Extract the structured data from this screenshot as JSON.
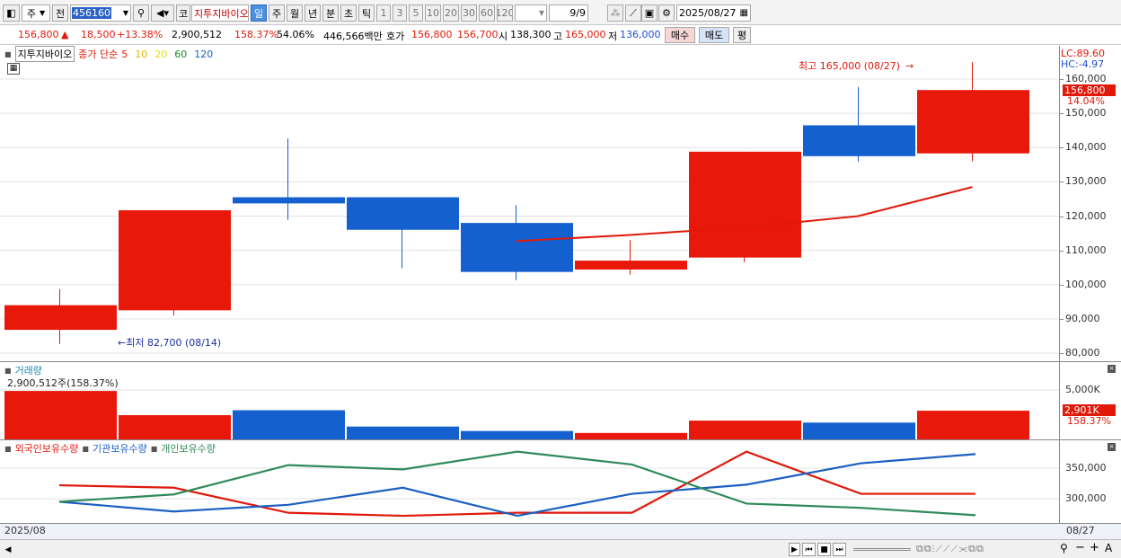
{
  "toolbar": {
    "period_type": "주",
    "prev_label": "전",
    "code": "456160",
    "stock_name": "지투지바이오",
    "kospi_label": "코",
    "periods": [
      "일",
      "주",
      "월",
      "년",
      "분",
      "초",
      "틱"
    ],
    "selected_period": "일",
    "intervals": [
      "1",
      "3",
      "5",
      "10",
      "20",
      "30",
      "60",
      "120"
    ],
    "page": "9/9",
    "date": "2025/08/27"
  },
  "infobar": {
    "price": "156,800",
    "change_arrow": "▲",
    "change": "18,500",
    "change_pct": "+13.38%",
    "volume": "2,900,512",
    "volume_pct": "158.37%",
    "turnover": "54.06%",
    "amount": "446,566백만",
    "quote_label": "호가",
    "ask": "156,800",
    "bid": "156,700",
    "open_label": "시",
    "open": "138,300",
    "high_label": "고",
    "high": "165,000",
    "low_label": "저",
    "low": "136,000",
    "buy_button": "매수",
    "sell_button": "매도",
    "eval_button": "평"
  },
  "chart_header": {
    "name": "지투지바이오",
    "ma_label": "종가 단순",
    "ma_periods": [
      {
        "label": "5",
        "color": "#e0190b"
      },
      {
        "label": "10",
        "color": "#e8b400"
      },
      {
        "label": "20",
        "color": "#e8e000"
      },
      {
        "label": "60",
        "color": "#1b8a2b"
      },
      {
        "label": "120",
        "color": "#1b5fc0"
      }
    ],
    "lc": "LC:89.60",
    "hc": "HC:-4.97"
  },
  "annotations": {
    "high": "최고 165,000 (08/27)",
    "low": "최저 82,700 (08/14)",
    "price_tag": "156,800",
    "price_pct": "14.04%"
  },
  "volume_panel": {
    "title": "거래량",
    "readout": "2,900,512주(158.37%)",
    "tag": "2,901K",
    "tag_pct": "158.37%"
  },
  "holdings_panel": {
    "legend": [
      {
        "label": "외국인보유수량",
        "color": "#e0190b"
      },
      {
        "label": "기관보유수량",
        "color": "#1b5fc0"
      },
      {
        "label": "개인보유수량",
        "color": "#2f8a5a"
      }
    ]
  },
  "x_axis": {
    "left_label": "2025/08",
    "right_label": "08/27"
  },
  "chart_data": [
    {
      "type": "candlestick",
      "y_axis_ticks": [
        "160,000",
        "150,000",
        "140,000",
        "130,000",
        "120,000",
        "110,000",
        "100,000",
        "90,000",
        "80,000"
      ],
      "ylim": [
        78000,
        166000
      ],
      "candles": [
        {
          "open": 86800,
          "close": 94000,
          "high": 98700,
          "low": 82700,
          "color": "red"
        },
        {
          "open": 92500,
          "close": 121700,
          "high": 121700,
          "low": 91000,
          "color": "red"
        },
        {
          "open": 125500,
          "close": 123700,
          "high": 142700,
          "low": 118900,
          "color": "blue"
        },
        {
          "open": 125500,
          "close": 116000,
          "high": 125500,
          "low": 104800,
          "color": "blue"
        },
        {
          "open": 118000,
          "close": 103700,
          "high": 123200,
          "low": 101300,
          "color": "blue"
        },
        {
          "open": 104400,
          "close": 107000,
          "high": 113000,
          "low": 102900,
          "color": "red"
        },
        {
          "open": 107900,
          "close": 138800,
          "high": 138800,
          "low": 106600,
          "color": "red"
        },
        {
          "open": 146500,
          "close": 137500,
          "high": 157700,
          "low": 135900,
          "color": "blue"
        },
        {
          "open": 138300,
          "close": 156800,
          "high": 165000,
          "low": 136000,
          "color": "red"
        }
      ],
      "ma5": [
        null,
        null,
        null,
        null,
        112700,
        114500,
        116700,
        120000,
        128500
      ]
    },
    {
      "type": "bar",
      "y_axis_ticks": [
        "5,000K"
      ],
      "ylim": [
        0,
        6500
      ],
      "values": [
        4900,
        2450,
        2950,
        1300,
        850,
        650,
        1900,
        1700,
        2901
      ],
      "colors": [
        "red",
        "red",
        "blue",
        "blue",
        "blue",
        "red",
        "red",
        "blue",
        "red"
      ]
    },
    {
      "type": "line",
      "y_axis_ticks": [
        "350,000",
        "300,000"
      ],
      "ylim": [
        265000,
        380000
      ],
      "series": [
        {
          "name": "외국인보유수량",
          "color": "#e0190b",
          "values": [
            322000,
            318000,
            277000,
            272000,
            277000,
            277000,
            377000,
            308000,
            308000
          ]
        },
        {
          "name": "기관보유수량",
          "color": "#1b5fc0",
          "values": [
            295000,
            279000,
            290000,
            318000,
            272000,
            308000,
            323000,
            358000,
            373000
          ]
        },
        {
          "name": "개인보유수량",
          "color": "#2f8a5a",
          "values": [
            295000,
            307000,
            355000,
            348000,
            377000,
            356000,
            292000,
            285000,
            273000
          ]
        }
      ]
    }
  ]
}
